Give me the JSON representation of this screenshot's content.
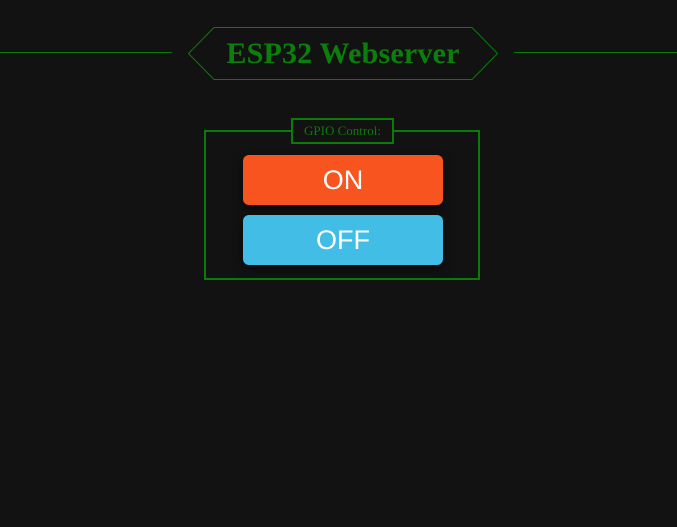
{
  "header": {
    "title": "ESP32 Webserver"
  },
  "gpio": {
    "legend": "GPIO Control:",
    "on_label": "ON",
    "off_label": "OFF"
  },
  "colors": {
    "background": "#121212",
    "accent_green": "#0b7a0b",
    "on_button": "#f8541f",
    "off_button": "#42bde6",
    "button_text": "#ffffff"
  }
}
